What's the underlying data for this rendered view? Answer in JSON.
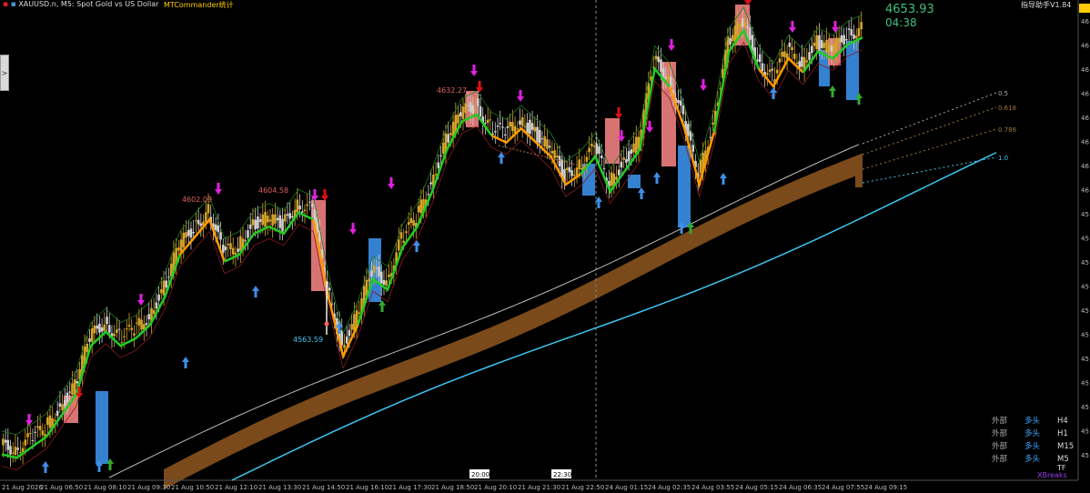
{
  "header": {
    "symbol_title": "XAUUSD.n, M5:  Spot Gold vs US Dollar",
    "indicator_title": "MTCommander统计",
    "right_title": "指导助手V1.84"
  },
  "side_tab": {
    "label": ">"
  },
  "price_box": {
    "price": "4653.93",
    "timer": "04:38"
  },
  "price_scale": [
    "46",
    "46",
    "46",
    "46",
    "46",
    "46",
    "46",
    "46",
    "45",
    "45",
    "45",
    "45",
    "45",
    "45",
    "45",
    "45",
    "45",
    "45",
    "45"
  ],
  "fib_labels": [
    "0.5",
    "0.618",
    "0.786",
    "1.0"
  ],
  "annotations": {
    "price_labels": [
      "4632.27",
      "4602.09",
      "4604.58",
      "4563.59"
    ],
    "session_markers": [
      "20:00",
      "22:30"
    ]
  },
  "trend_table": {
    "rows": [
      {
        "source": "外部",
        "state": "多头",
        "tf": "H4"
      },
      {
        "source": "外部",
        "state": "多头",
        "tf": "H1"
      },
      {
        "source": "外部",
        "state": "多头",
        "tf": "M15"
      },
      {
        "source": "外部",
        "state": "多头",
        "tf": "M5"
      }
    ],
    "corner_tf": "TF",
    "footer": "XBreaks"
  },
  "colors": {
    "background": "#000000",
    "bull_candle": "#d4a32a",
    "bear_candle": "#cfcfcf",
    "trend_green": "#22cc22",
    "trend_orange": "#ff9900",
    "band_brown": "#7a4a1a",
    "cyan_line": "#3cc6f0",
    "sell_arrow": "#e01010",
    "magenta_arrow": "#e020e0",
    "buy_arrow": "#3f8fe8",
    "green_arrow": "#33aa33"
  },
  "chart_data": {
    "type": "candlestick",
    "title": "XAUUSD.n, M5:  Spot Gold vs US Dollar",
    "xlabel": "",
    "ylabel": "",
    "x_tick_labels": [
      "21 Aug 2026",
      "21 Aug 06:50",
      "21 Aug 08:10",
      "21 Aug 09:30",
      "21 Aug 10:50",
      "21 Aug 12:10",
      "21 Aug 13:30",
      "21 Aug 14:50",
      "21 Aug 16:10",
      "21 Aug 17:30",
      "21 Aug 18:50",
      "21 Aug 20:10",
      "21 Aug 21:30",
      "21 Aug 22:50",
      "24 Aug 01:15",
      "24 Aug 02:35",
      "24 Aug 03:55",
      "24 Aug 05:15",
      "24 Aug 06:35",
      "24 Aug 07:55",
      "24 Aug 09:15"
    ],
    "ylim": [
      4525,
      4660
    ],
    "price_points": [
      {
        "label": "4632.27",
        "value": 4632.27
      },
      {
        "label": "4602.09",
        "value": 4602.09
      },
      {
        "label": "4604.58",
        "value": 4604.58
      },
      {
        "label": "4563.59",
        "value": 4563.59
      },
      {
        "label": "4653.93",
        "value": 4653.93
      }
    ],
    "series": [
      {
        "name": "price",
        "values": [
          4535,
          4534,
          4537,
          4540,
          4546,
          4552,
          4566,
          4570,
          4566,
          4568,
          4572,
          4580,
          4592,
          4597,
          4602,
          4590,
          4592,
          4598,
          4600,
          4598,
          4604,
          4602,
          4580,
          4563,
          4572,
          4585,
          4582,
          4594,
          4600,
          4610,
          4622,
          4630,
          4632,
          4626,
          4624,
          4628,
          4624,
          4620,
          4612,
          4615,
          4620,
          4610,
          4616,
          4622,
          4645,
          4640,
          4628,
          4612,
          4627,
          4650,
          4656,
          4645,
          4640,
          4648,
          4644,
          4650,
          4648,
          4652,
          4653.93
        ]
      }
    ],
    "legend": "none",
    "grid": false
  }
}
